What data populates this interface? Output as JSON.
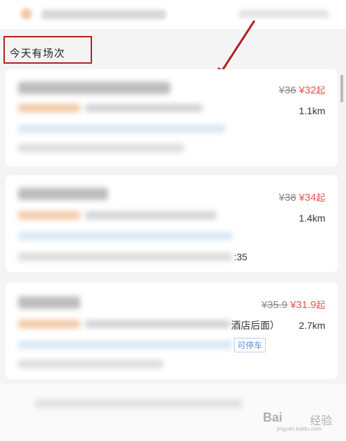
{
  "section": {
    "title": "今天有场次"
  },
  "cards": [
    {
      "old_price": "¥36",
      "new_price": "¥32",
      "suffix": "起",
      "distance": "1.1km"
    },
    {
      "old_price": "¥38",
      "new_price": "¥34",
      "suffix": "起",
      "distance": "1.4km",
      "time_fragment": ":35"
    },
    {
      "old_price": "¥35.9",
      "new_price": "¥31.9",
      "suffix": "起",
      "distance": "2.7km",
      "address_fragment": "酒店后面）",
      "tag_parking": "可停车"
    }
  ],
  "watermark": {
    "brand": "Bai",
    "brand_suffix": "经验",
    "domain": "jingyan.baidu.com"
  },
  "colors": {
    "accent": "#e8554e",
    "annotation_red": "#b02222",
    "tag_blue": "#5b8fd6"
  }
}
